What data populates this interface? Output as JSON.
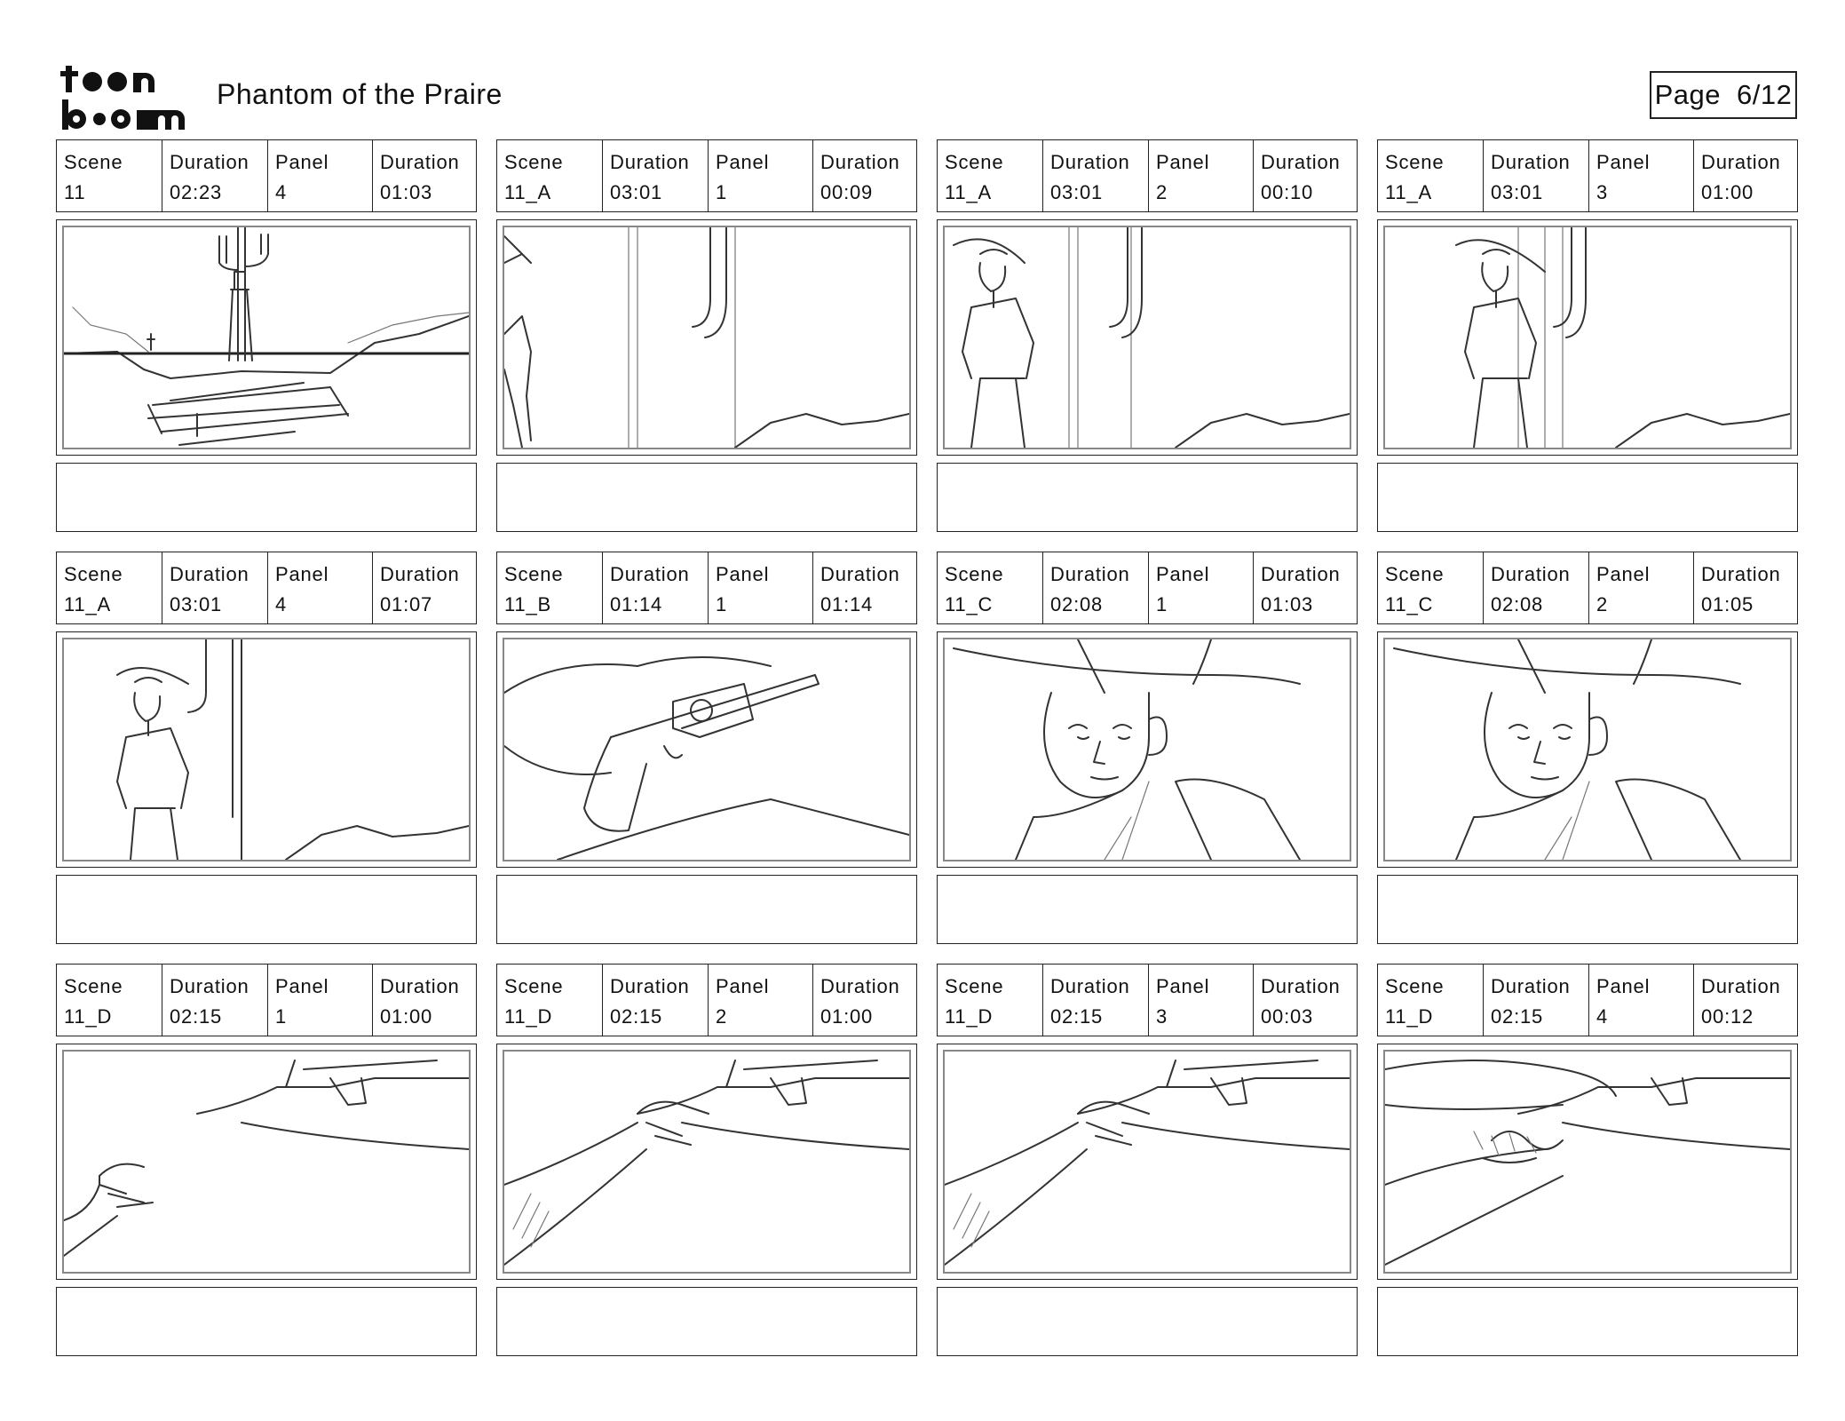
{
  "header": {
    "logo_text": "toonboom",
    "title": "Phantom of the Praire",
    "page_label": "Page",
    "page_number": "6/12"
  },
  "labels": {
    "scene": "Scene",
    "duration": "Duration",
    "panel": "Panel"
  },
  "panels": [
    {
      "scene": "11",
      "scene_duration": "02:23",
      "panel": "4",
      "panel_duration": "01:03",
      "sketch": "wide-desert-cactus-campfire"
    },
    {
      "scene": "11_A",
      "scene_duration": "03:01",
      "panel": "1",
      "panel_duration": "00:09",
      "sketch": "cowboy-entering-frame"
    },
    {
      "scene": "11_A",
      "scene_duration": "03:01",
      "panel": "2",
      "panel_duration": "00:10",
      "sketch": "cowboy-standing-left"
    },
    {
      "scene": "11_A",
      "scene_duration": "03:01",
      "panel": "3",
      "panel_duration": "01:00",
      "sketch": "cowboy-standing-center"
    },
    {
      "scene": "11_A",
      "scene_duration": "03:01",
      "panel": "4",
      "panel_duration": "01:07",
      "sketch": "cowboy-by-cactus"
    },
    {
      "scene": "11_B",
      "scene_duration": "01:14",
      "panel": "1",
      "panel_duration": "01:14",
      "sketch": "revolver-closeup"
    },
    {
      "scene": "11_C",
      "scene_duration": "02:08",
      "panel": "1",
      "panel_duration": "01:03",
      "sketch": "cowboy-face-closeup"
    },
    {
      "scene": "11_C",
      "scene_duration": "02:08",
      "panel": "2",
      "panel_duration": "01:05",
      "sketch": "cowboy-face-closeup"
    },
    {
      "scene": "11_D",
      "scene_duration": "02:15",
      "panel": "1",
      "panel_duration": "01:00",
      "sketch": "hand-reaching-revolver"
    },
    {
      "scene": "11_D",
      "scene_duration": "02:15",
      "panel": "2",
      "panel_duration": "01:00",
      "sketch": "hand-grabbing-revolver"
    },
    {
      "scene": "11_D",
      "scene_duration": "02:15",
      "panel": "3",
      "panel_duration": "00:03",
      "sketch": "hand-grabbing-revolver"
    },
    {
      "scene": "11_D",
      "scene_duration": "02:15",
      "panel": "4",
      "panel_duration": "00:12",
      "sketch": "hand-on-revolver-hat"
    }
  ]
}
